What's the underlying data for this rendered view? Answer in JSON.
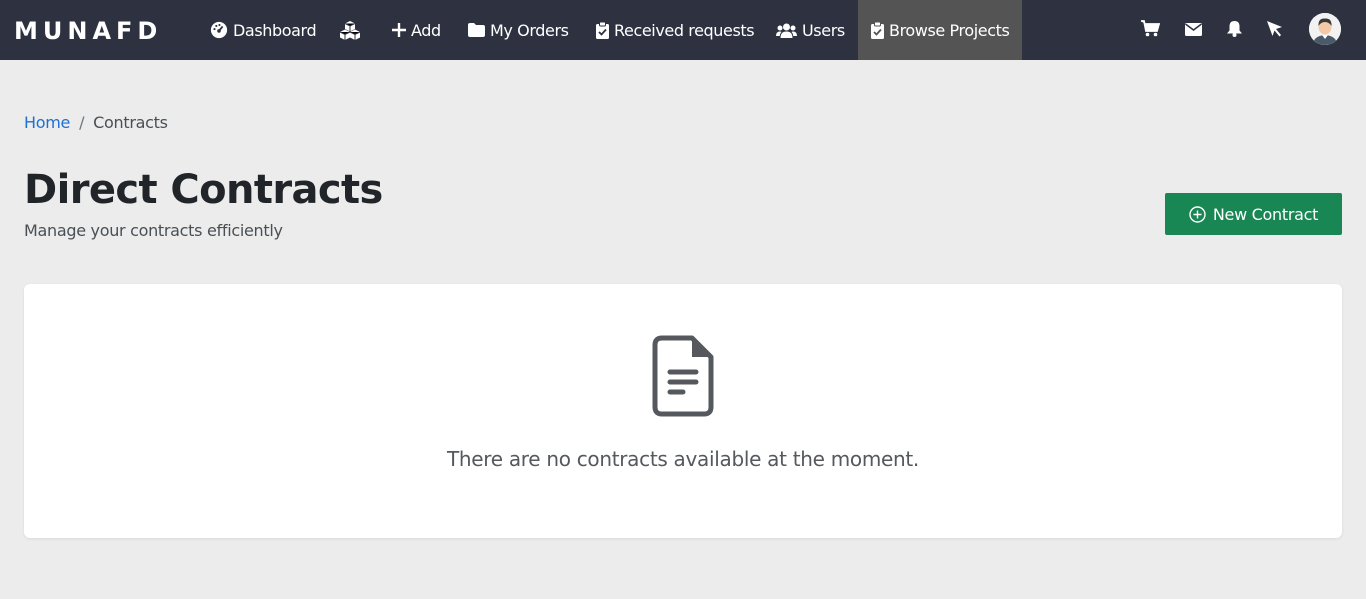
{
  "app": {
    "brand": "MUNAFD"
  },
  "nav": {
    "dashboard": "Dashboard",
    "add": "Add",
    "my_orders": "My Orders",
    "received_requests": "Received requests",
    "users": "Users",
    "browse_projects": "Browse Projects",
    "active_item": "Browse Projects"
  },
  "icons": {
    "dashboard": "gauge-icon",
    "services": "cubes-icon",
    "add": "plus-icon",
    "my_orders": "folder-icon",
    "received_requests": "clipboard-check-icon",
    "users": "users-icon",
    "browse_projects": "clipboard-check-icon",
    "cart": "cart-icon",
    "messages": "envelope-icon",
    "notifications": "bell-icon",
    "pointer": "cursor-icon",
    "profile": "avatar",
    "new_contract": "plus-circle-icon",
    "empty_state": "document-icon"
  },
  "breadcrumb": {
    "home": "Home",
    "separator": "/",
    "current": "Contracts"
  },
  "page": {
    "title": "Direct Contracts",
    "subtitle": "Manage your contracts efficiently",
    "new_button": "New Contract"
  },
  "empty_state": {
    "message": "There are no contracts available at the moment."
  },
  "colors": {
    "navbar_bg": "#2e3240",
    "active_nav_bg": "#545454",
    "page_bg": "#ececec",
    "primary_button": "#198754",
    "link": "#1f6fd1"
  }
}
